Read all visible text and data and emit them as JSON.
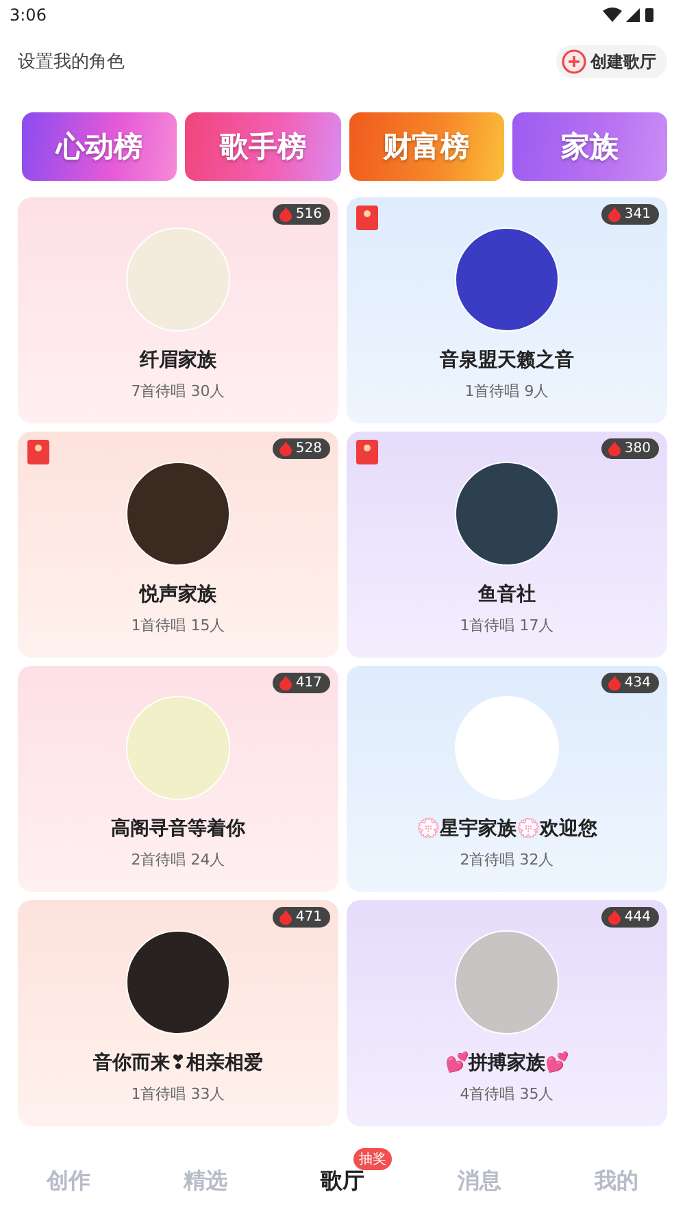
{
  "status_bar": {
    "time": "3:06"
  },
  "header": {
    "role_link": "设置我的角色",
    "create_button": "创建歌厅"
  },
  "banners": [
    {
      "label": "心动榜",
      "kind": "heart"
    },
    {
      "label": "歌手榜",
      "kind": "singer"
    },
    {
      "label": "财富榜",
      "kind": "wealth"
    },
    {
      "label": "家族",
      "kind": "family"
    }
  ],
  "rooms": [
    {
      "name": "纤眉家族",
      "stats": "7首待唱 30人",
      "heat": "516",
      "tagged": false
    },
    {
      "name": "音泉盟天籁之音",
      "stats": "1首待唱 9人",
      "heat": "341",
      "tagged": true
    },
    {
      "name": "悦声家族",
      "stats": "1首待唱 15人",
      "heat": "528",
      "tagged": true
    },
    {
      "name": "鱼音社",
      "stats": "1首待唱 17人",
      "heat": "380",
      "tagged": true
    },
    {
      "name": "高阁寻音等着你",
      "stats": "2首待唱 24人",
      "heat": "417",
      "tagged": false
    },
    {
      "name": "💮星宇家族💮欢迎您",
      "stats": "2首待唱 32人",
      "heat": "434",
      "tagged": false
    },
    {
      "name": "音你而来❣相亲相爱",
      "stats": "1首待唱 33人",
      "heat": "471",
      "tagged": false
    },
    {
      "name": "💕拼搏家族💕",
      "stats": "4首待唱 35人",
      "heat": "444",
      "tagged": false
    }
  ],
  "tab_bar": [
    {
      "label": "创作",
      "selected": false
    },
    {
      "label": "精选",
      "selected": false
    },
    {
      "label": "歌厅",
      "selected": true,
      "badge": "抽奖"
    },
    {
      "label": "消息",
      "selected": false
    },
    {
      "label": "我的",
      "selected": false
    }
  ]
}
